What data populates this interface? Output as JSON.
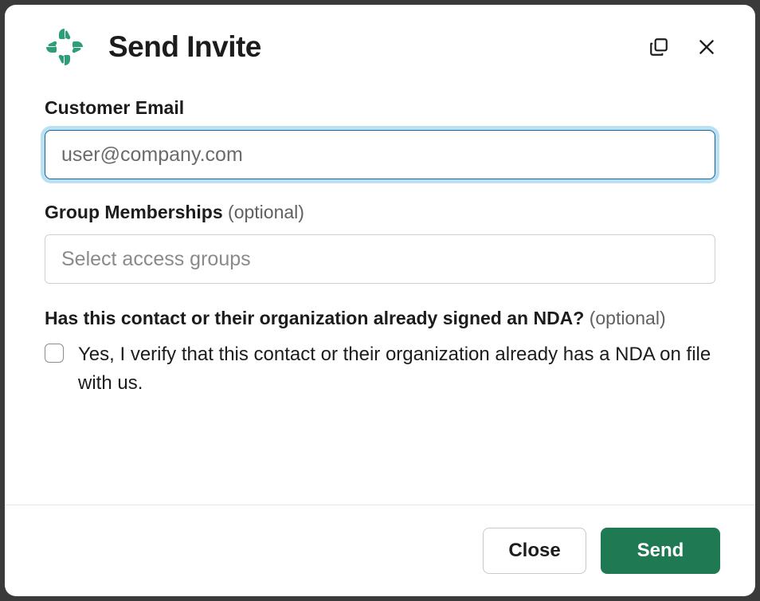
{
  "header": {
    "title": "Send Invite"
  },
  "form": {
    "emailLabel": "Customer Email",
    "emailPlaceholder": "user@company.com",
    "emailValue": "",
    "groupLabel": "Group Memberships",
    "groupOptional": "(optional)",
    "groupPlaceholder": "Select access groups",
    "ndaLabel": "Has this contact or their organization already signed an NDA?",
    "ndaOptional": "(optional)",
    "ndaCheckboxText": "Yes, I verify that this contact or their organization already has a NDA on file with us.",
    "ndaChecked": false
  },
  "footer": {
    "closeLabel": "Close",
    "sendLabel": "Send"
  },
  "colors": {
    "primary": "#1f7a54",
    "logoGreen": "#2e9e7a",
    "focusBlue": "#1264a3"
  }
}
